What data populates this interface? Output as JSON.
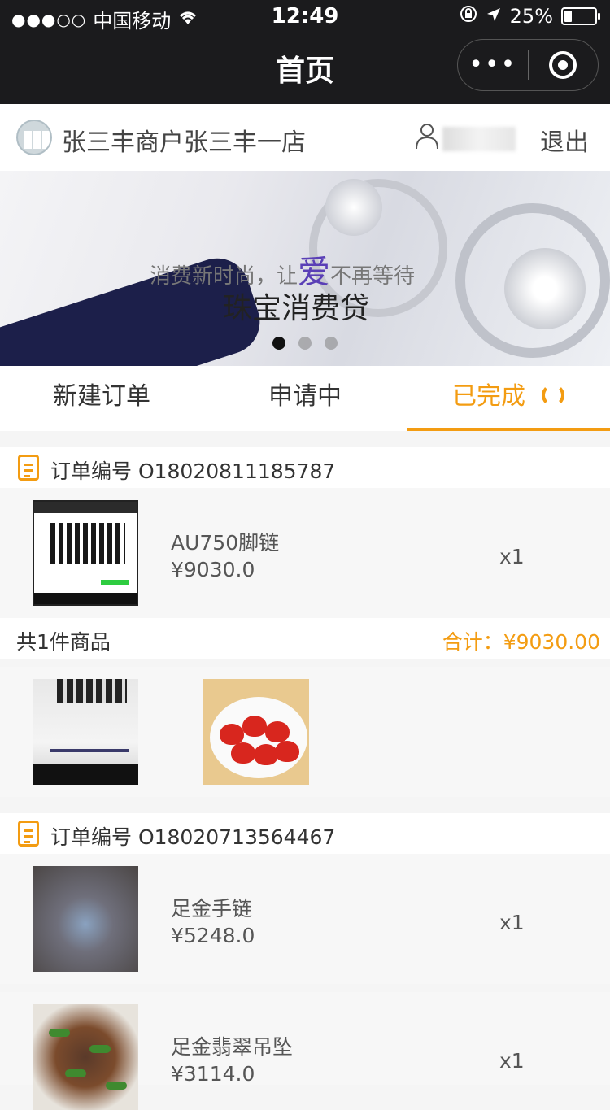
{
  "status_bar": {
    "carrier": "中国移动",
    "signal": "●●●○○",
    "time": "12:49",
    "battery": "25%"
  },
  "nav": {
    "title": "首页",
    "more": "•••"
  },
  "merchant": {
    "name": "张三丰商户张三丰一店",
    "logout": "退出"
  },
  "banner": {
    "line1_a": "消费新时尚，让",
    "line1_love": "爱",
    "line1_b": "不再等待",
    "line2": "珠宝消费贷",
    "slides": 3,
    "active_slide": 1
  },
  "tabs": [
    {
      "label": "新建订单",
      "active": false
    },
    {
      "label": "申请中",
      "active": false
    },
    {
      "label": "已完成",
      "active": true
    }
  ],
  "orders": [
    {
      "number_text": "订单编号 O18020811185787",
      "items": [
        {
          "name": "AU750脚链",
          "price": "¥9030.0",
          "qty": "x1"
        }
      ],
      "count_text": "共1件商品",
      "total_text": "合计：¥9030.00"
    },
    {
      "number_text": "订单编号 O18020713564467",
      "items": [
        {
          "name": "足金手链",
          "price": "¥5248.0",
          "qty": "x1"
        },
        {
          "name": "足金翡翠吊坠",
          "price": "¥3114.0",
          "qty": "x1"
        }
      ]
    }
  ],
  "colors": {
    "accent": "#f39c12",
    "navbar": "#1b1b1d"
  },
  "icons": [
    "wifi-icon",
    "lock-rotation-icon",
    "location-arrow-icon",
    "battery-icon",
    "more-icon",
    "target-icon",
    "user-icon",
    "refresh-icon",
    "order-list-icon"
  ]
}
